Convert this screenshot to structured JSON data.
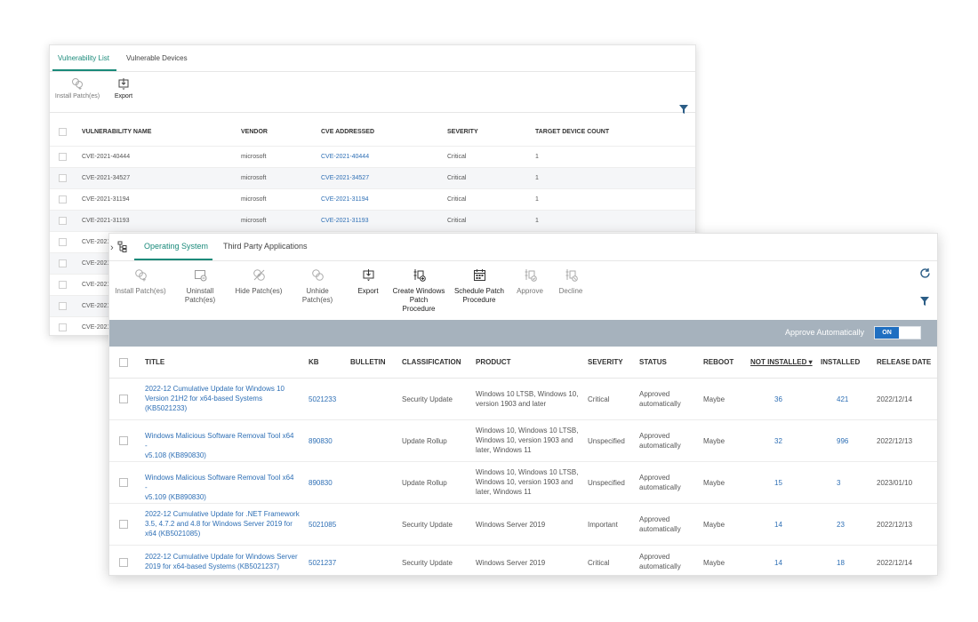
{
  "colors": {
    "accent": "#1a8a7a",
    "link": "#2e6fb5",
    "toggle": "#1f6fc1",
    "bar": "#a6b2bd"
  },
  "back_panel": {
    "tabs": [
      "Vulnerability List",
      "Vulnerable Devices"
    ],
    "toolbar": {
      "install": "Install Patch(es)",
      "export": "Export"
    },
    "columns": [
      "VULNERABILITY NAME",
      "VENDOR",
      "CVE ADDRESSED",
      "SEVERITY",
      "TARGET DEVICE COUNT"
    ],
    "rows": [
      {
        "name": "CVE-2021-40444",
        "vendor": "microsoft",
        "cve": "CVE-2021-40444",
        "severity": "Critical",
        "count": "1"
      },
      {
        "name": "CVE-2021-34527",
        "vendor": "microsoft",
        "cve": "CVE-2021-34527",
        "severity": "Critical",
        "count": "1"
      },
      {
        "name": "CVE-2021-31194",
        "vendor": "microsoft",
        "cve": "CVE-2021-31194",
        "severity": "Critical",
        "count": "1"
      },
      {
        "name": "CVE-2021-31193",
        "vendor": "microsoft",
        "cve": "CVE-2021-31193",
        "severity": "Critical",
        "count": "1"
      },
      {
        "name": "CVE-2021",
        "vendor": "",
        "cve": "",
        "severity": "",
        "count": ""
      },
      {
        "name": "CVE-2021",
        "vendor": "",
        "cve": "",
        "severity": "",
        "count": ""
      },
      {
        "name": "CVE-2021",
        "vendor": "",
        "cve": "",
        "severity": "",
        "count": ""
      },
      {
        "name": "CVE-2021",
        "vendor": "",
        "cve": "",
        "severity": "",
        "count": ""
      },
      {
        "name": "CVE-2021",
        "vendor": "",
        "cve": "",
        "severity": "",
        "count": ""
      }
    ]
  },
  "front_panel": {
    "tabs": [
      "Operating System",
      "Third Party Applications"
    ],
    "toolbar": {
      "install": "Install Patch(es)",
      "uninstall_1": "Uninstall",
      "uninstall_2": "Patch(es)",
      "hide": "Hide Patch(es)",
      "unhide_1": "Unhide",
      "unhide_2": "Patch(es)",
      "export": "Export",
      "create_1": "Create Windows",
      "create_2": "Patch",
      "create_3": "Procedure",
      "schedule_1": "Schedule Patch",
      "schedule_2": "Procedure",
      "approve": "Approve",
      "decline": "Decline"
    },
    "approve_auto": {
      "label": "Approve Automatically",
      "state": "ON"
    },
    "columns": {
      "title": "TITLE",
      "kb": "KB",
      "bulletin": "BULLETIN",
      "classification": "CLASSIFICATION",
      "product": "PRODUCT",
      "severity": "SEVERITY",
      "status": "STATUS",
      "reboot": "REBOOT",
      "not_installed": "NOT INSTALLED",
      "installed": "INSTALLED",
      "release_date": "RELEASE DATE"
    },
    "rows": [
      {
        "title": [
          "2022-12 Cumulative Update for Windows 10",
          "Version 21H2 for x64-based Systems",
          "(KB5021233)"
        ],
        "kb": "5021233",
        "classification": "Security Update",
        "product": [
          "Windows 10 LTSB, Windows 10,",
          "version 1903 and later"
        ],
        "severity": "Critical",
        "status": [
          "Approved",
          "automatically"
        ],
        "reboot": "Maybe",
        "not_installed": "36",
        "installed": "421",
        "release_date": "2022/12/14"
      },
      {
        "title": [
          "Windows Malicious Software Removal Tool x64 -",
          "v5.108 (KB890830)"
        ],
        "kb": "890830",
        "classification": "Update Rollup",
        "product": [
          "Windows 10, Windows 10 LTSB,",
          "Windows 10, version 1903 and",
          "later, Windows 11"
        ],
        "severity": "Unspecified",
        "status": [
          "Approved",
          "automatically"
        ],
        "reboot": "Maybe",
        "not_installed": "32",
        "installed": "996",
        "release_date": "2022/12/13"
      },
      {
        "title": [
          "Windows Malicious Software Removal Tool x64 -",
          "v5.109 (KB890830)"
        ],
        "kb": "890830",
        "classification": "Update Rollup",
        "product": [
          "Windows 10, Windows 10 LTSB,",
          "Windows 10, version 1903 and",
          "later, Windows 11"
        ],
        "severity": "Unspecified",
        "status": [
          "Approved",
          "automatically"
        ],
        "reboot": "Maybe",
        "not_installed": "15",
        "installed": "3",
        "release_date": "2023/01/10"
      },
      {
        "title": [
          "2022-12 Cumulative Update for .NET Framework",
          "3.5, 4.7.2 and 4.8 for Windows Server 2019 for",
          "x64 (KB5021085)"
        ],
        "kb": "5021085",
        "classification": "Security Update",
        "product": [
          "Windows Server 2019"
        ],
        "severity": "Important",
        "status": [
          "Approved",
          "automatically"
        ],
        "reboot": "Maybe",
        "not_installed": "14",
        "installed": "23",
        "release_date": "2022/12/13"
      },
      {
        "title": [
          "2022-12 Cumulative Update for Windows Server",
          "2019 for x64-based Systems (KB5021237)"
        ],
        "kb": "5021237",
        "classification": "Security Update",
        "product": [
          "Windows Server 2019"
        ],
        "severity": "Critical",
        "status": [
          "Approved",
          "automatically"
        ],
        "reboot": "Maybe",
        "not_installed": "14",
        "installed": "18",
        "release_date": "2022/12/14"
      }
    ]
  }
}
